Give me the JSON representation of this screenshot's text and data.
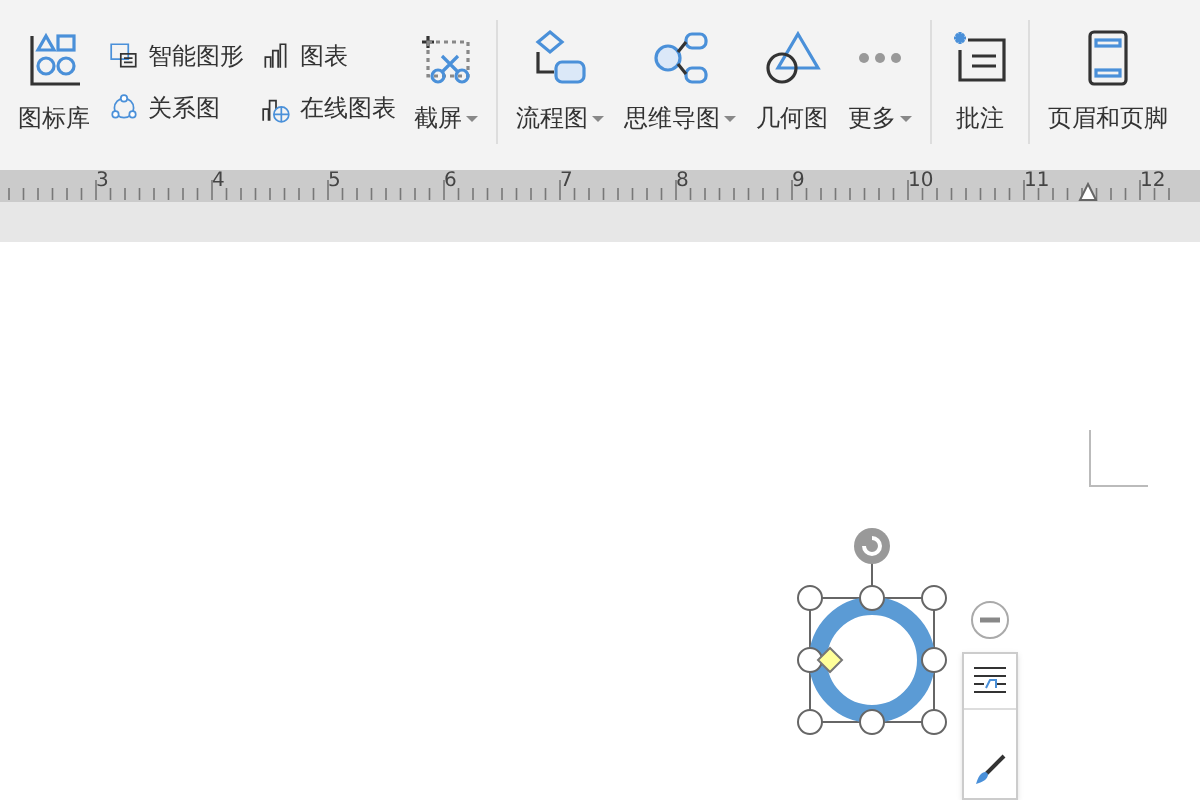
{
  "toolbar": {
    "groups": [
      {
        "kind": "stack",
        "items": [
          {
            "label": "图标库"
          }
        ]
      },
      {
        "kind": "pair",
        "items": [
          {
            "label": "智能图形"
          },
          {
            "label": "关系图"
          }
        ]
      },
      {
        "kind": "pair",
        "items": [
          {
            "label": "图表"
          },
          {
            "label": "在线图表"
          }
        ]
      },
      {
        "kind": "stack",
        "items": [
          {
            "label": "截屏",
            "dropdown": true
          }
        ]
      },
      {
        "kind": "divider"
      },
      {
        "kind": "stack",
        "items": [
          {
            "label": "流程图",
            "dropdown": true
          }
        ]
      },
      {
        "kind": "stack",
        "items": [
          {
            "label": "思维导图",
            "dropdown": true
          }
        ]
      },
      {
        "kind": "stack",
        "items": [
          {
            "label": "几何图"
          }
        ]
      },
      {
        "kind": "stack",
        "items": [
          {
            "label": "更多",
            "dropdown": true
          }
        ]
      },
      {
        "kind": "divider"
      },
      {
        "kind": "stack",
        "items": [
          {
            "label": "批注"
          }
        ]
      },
      {
        "kind": "divider"
      },
      {
        "kind": "stack",
        "items": [
          {
            "label": "页眉和页脚"
          }
        ]
      }
    ]
  },
  "ruler": {
    "numbers": [
      "3",
      "4",
      "5",
      "6",
      "7",
      "8",
      "9",
      "10",
      "11",
      "12"
    ]
  }
}
